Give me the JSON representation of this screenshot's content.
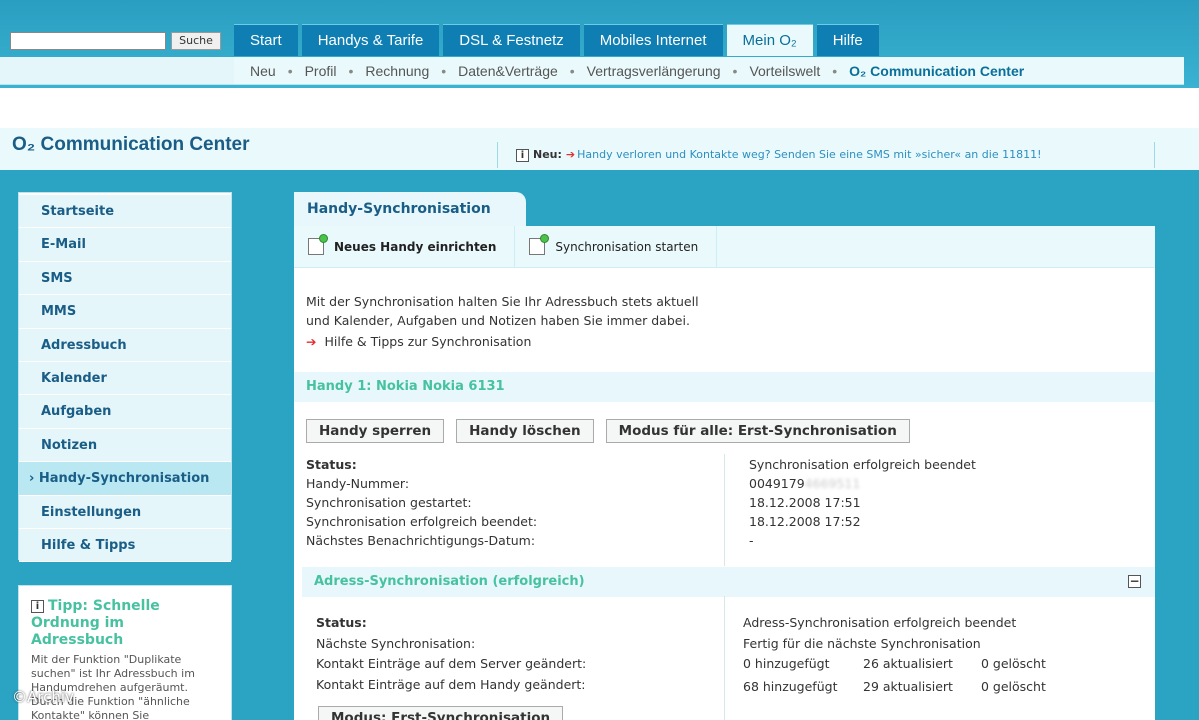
{
  "header": {
    "search_placeholder": "",
    "search_button": "Suche",
    "tabs": [
      "Start",
      "Handys & Tarife",
      "DSL & Festnetz",
      "Mobiles Internet",
      "Mein O₂",
      "Hilfe"
    ],
    "active_tab": "Mein O₂",
    "subnav": [
      "Neu",
      "Profil",
      "Rechnung",
      "Daten&Verträge",
      "Vertragsverlängerung",
      "Vorteilswelt",
      "O₂ Communication Center"
    ]
  },
  "title": "O₂ Communication Center",
  "news": {
    "label": "Neu:",
    "text": "Handy verloren und Kontakte weg? Senden Sie eine SMS mit »sicher« an die 11811!"
  },
  "sidebar": {
    "items": [
      "Startseite",
      "E-Mail",
      "SMS",
      "MMS",
      "Adressbuch",
      "Kalender",
      "Aufgaben",
      "Notizen",
      "› Handy-Synchronisation",
      "Einstellungen",
      "Hilfe & Tipps"
    ],
    "active": "› Handy-Synchronisation"
  },
  "tip": {
    "title": "Tipp: Schnelle Ordnung im Adressbuch",
    "text": "Mit der Funktion \"Duplikate suchen\" ist Ihr Adressbuch im Handumdrehen aufgeräumt. Durch die Funktion \"ähnliche Kontakte\" können Sie"
  },
  "main": {
    "tab_title": "Handy-Synchronisation",
    "toolbar": [
      "Neues Handy einrichten",
      "Synchronisation starten"
    ],
    "intro_line1": "Mit der Synchronisation halten Sie Ihr Adressbuch stets aktuell",
    "intro_line2": "und Kalender, Aufgaben und Notizen haben Sie immer dabei.",
    "help_link": "Hilfe & Tipps zur Synchronisation",
    "device_head": "Handy 1: Nokia Nokia 6131",
    "device_buttons": [
      "Handy sperren",
      "Handy löschen",
      "Modus für alle: Erst-Synchronisation"
    ],
    "device_status": {
      "labels": [
        "Status:",
        "Handy-Nummer:",
        "Synchronisation gestartet:",
        "Synchronisation erfolgreich beendet:",
        "Nächstes Benachrichtigungs-Datum:"
      ],
      "values": [
        "Synchronisation erfolgreich beendet",
        "0049179",
        "18.12.2008 17:51",
        "18.12.2008 17:52",
        "-"
      ]
    },
    "adress_head": "Adress-Synchronisation (erfolgreich)",
    "collapse": "−",
    "adress_status": {
      "labels": [
        "Status:",
        "Nächste Synchronisation:",
        "Kontakt Einträge auf dem Server geändert:",
        "Kontakt Einträge auf dem Handy geändert:"
      ],
      "values": [
        "Adress-Synchronisation erfolgreich beendet",
        "Fertig für die nächste Synchronisation"
      ],
      "server": [
        "0 hinzugefügt",
        "26 aktualisiert",
        "0 gelöscht"
      ],
      "handy": [
        "68 hinzugefügt",
        "29 aktualisiert",
        "0 gelöscht"
      ]
    },
    "mode_button": "Modus: Erst-Synchronisation"
  },
  "watermark": "©Archiv"
}
